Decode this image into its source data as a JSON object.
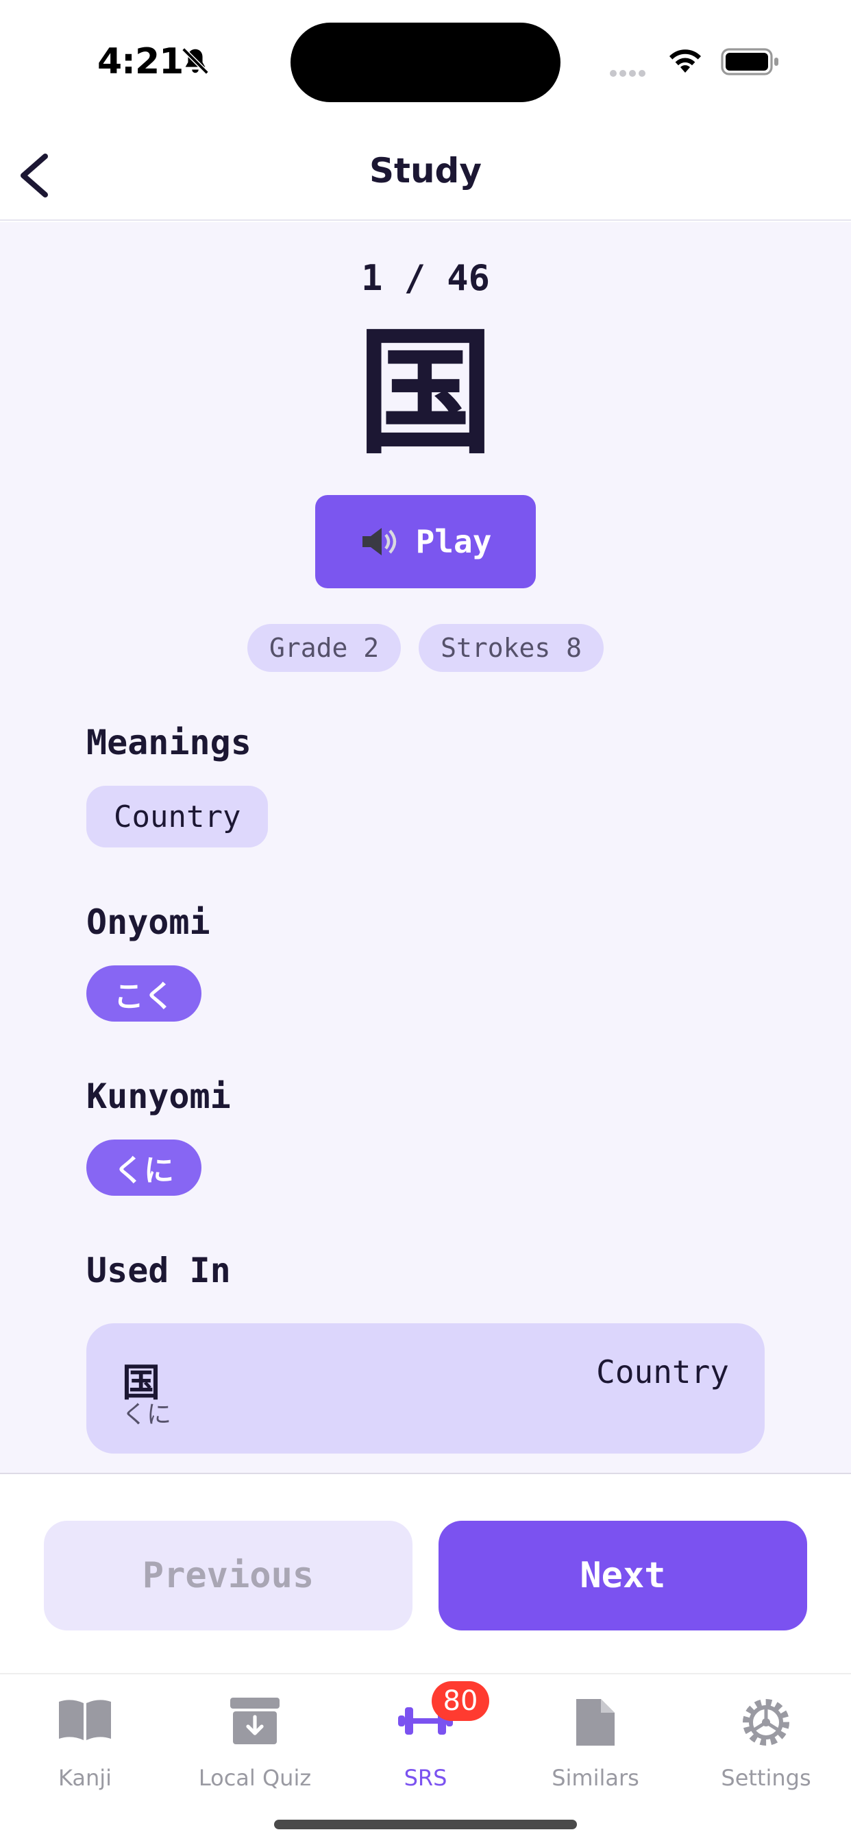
{
  "status_bar": {
    "time": "4:21"
  },
  "nav": {
    "title": "Study"
  },
  "study": {
    "counter": "1 / 46",
    "kanji": "国",
    "play_label": "Play",
    "grade": "Grade 2",
    "strokes": "Strokes 8"
  },
  "sections": {
    "meanings": {
      "title": "Meanings",
      "items": [
        "Country"
      ]
    },
    "onyomi": {
      "title": "Onyomi",
      "items": [
        "こく"
      ]
    },
    "kunyomi": {
      "title": "Kunyomi",
      "items": [
        "くに"
      ]
    },
    "used_in": {
      "title": "Used In",
      "items": [
        {
          "word": "国",
          "reading": "くに",
          "meaning": "Country"
        }
      ]
    }
  },
  "footer": {
    "previous_label": "Previous",
    "next_label": "Next"
  },
  "tabbar": {
    "tabs": [
      {
        "label": "Kanji",
        "icon": "book-icon"
      },
      {
        "label": "Local Quiz",
        "icon": "archive-box-icon"
      },
      {
        "label": "SRS",
        "icon": "dumbbell-icon",
        "active": true,
        "badge": "80"
      },
      {
        "label": "Similars",
        "icon": "document-icon"
      },
      {
        "label": "Settings",
        "icon": "gear-icon"
      }
    ]
  },
  "colors": {
    "accent": "#7b52f0",
    "chip_bg": "#ded8fc",
    "reading_tag": "#8766f3",
    "badge": "#ff3b30"
  }
}
